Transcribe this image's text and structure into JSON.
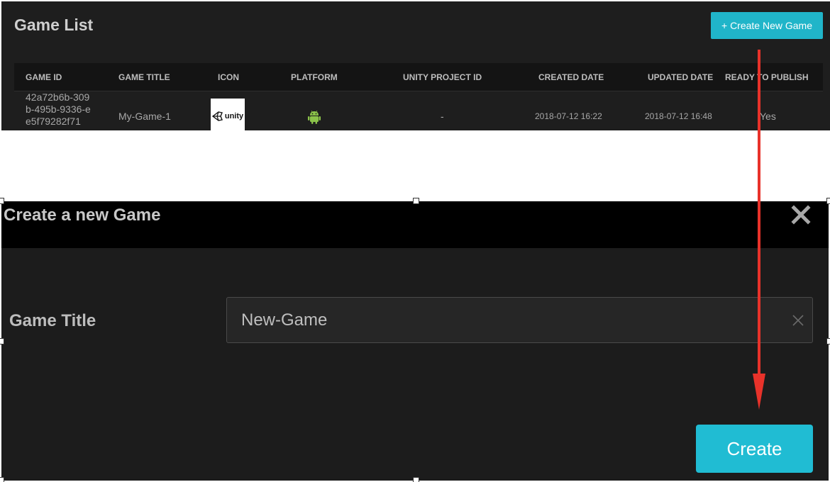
{
  "game_list": {
    "title": "Game List",
    "create_button_label": "+ Create New Game",
    "columns": {
      "game_id": "GAME ID",
      "game_title": "GAME TITLE",
      "icon": "ICON",
      "platform": "PLATFORM",
      "unity_project_id": "UNITY PROJECT ID",
      "created_date": "CREATED DATE",
      "updated_date": "UPDATED DATE",
      "ready_to_publish": "READY TO PUBLISH"
    },
    "rows": [
      {
        "game_id": "42a72b6b-309b-495b-9336-ee5f79282f71",
        "game_title": "My-Game-1",
        "icon": "unity-logo-icon",
        "icon_text": "unity",
        "platform": "android-icon",
        "unity_project_id": "-",
        "created_date": "2018-07-12 16:22",
        "updated_date": "2018-07-12 16:48",
        "ready_to_publish": "Yes"
      }
    ]
  },
  "dialog": {
    "title": "Create a new Game",
    "close_icon": "close-icon",
    "field_label": "Game Title",
    "field_value": "New-Game",
    "clear_icon": "clear-icon",
    "create_label": "Create"
  },
  "colors": {
    "accent": "#20b5c9",
    "android_green": "#8bc34a",
    "annotation_arrow": "#e8322a"
  }
}
